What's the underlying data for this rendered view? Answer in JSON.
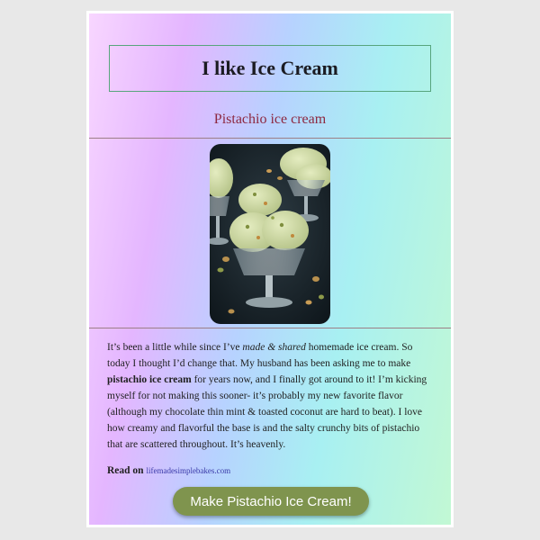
{
  "header": {
    "title": "I like Ice Cream"
  },
  "recipe": {
    "subtitle": "Pistachio ice cream",
    "image_alt": "Pistachio ice cream scoops in glass dessert cups",
    "body": {
      "p1": "It’s been a little while since I’ve ",
      "em": "made & shared",
      "p2": " homemade ice cream. So today I thought I’d change that. My husband has been asking me to make ",
      "strong": "pistachio ice cream",
      "p3": " for years now, and I finally got around to it! I’m kicking myself for not making this sooner- it’s probably my new favorite flavor (although my chocolate thin mint & toasted coconut are hard to beat). I love how creamy and flavorful the base is and the salty crunchy bits of pistachio that are scattered throughout. It’s heavenly."
    },
    "read_on_label": "Read on",
    "read_on_link": "lifemadesimplebakes.com",
    "cta_label": "Make Pistachio Ice Cream!"
  },
  "colors": {
    "accent": "#7f944e",
    "subtitle": "#8d2840",
    "title_border": "#57a57d"
  }
}
